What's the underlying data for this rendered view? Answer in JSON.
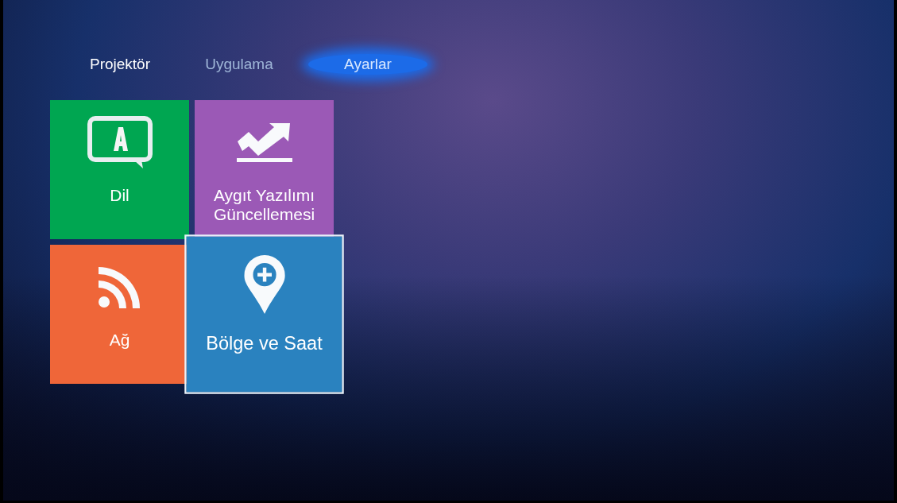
{
  "tabs": [
    {
      "label": "Projektör",
      "selected": false,
      "dimmed": false
    },
    {
      "label": "Uygulama",
      "selected": false,
      "dimmed": true
    },
    {
      "label": "Ayarlar",
      "selected": true,
      "dimmed": false
    }
  ],
  "tiles": [
    {
      "kind": "language",
      "label": "Dil",
      "color": "#00a651",
      "focused": false
    },
    {
      "kind": "update",
      "label": "Aygıt Yazılımı Güncellemesi",
      "color": "#9b59b6",
      "focused": false
    },
    {
      "kind": "network",
      "label": "Ağ",
      "color": "#ef6639",
      "focused": false
    },
    {
      "kind": "location",
      "label": "Bölge ve Saat",
      "color": "#2a82bf",
      "focused": true
    }
  ]
}
